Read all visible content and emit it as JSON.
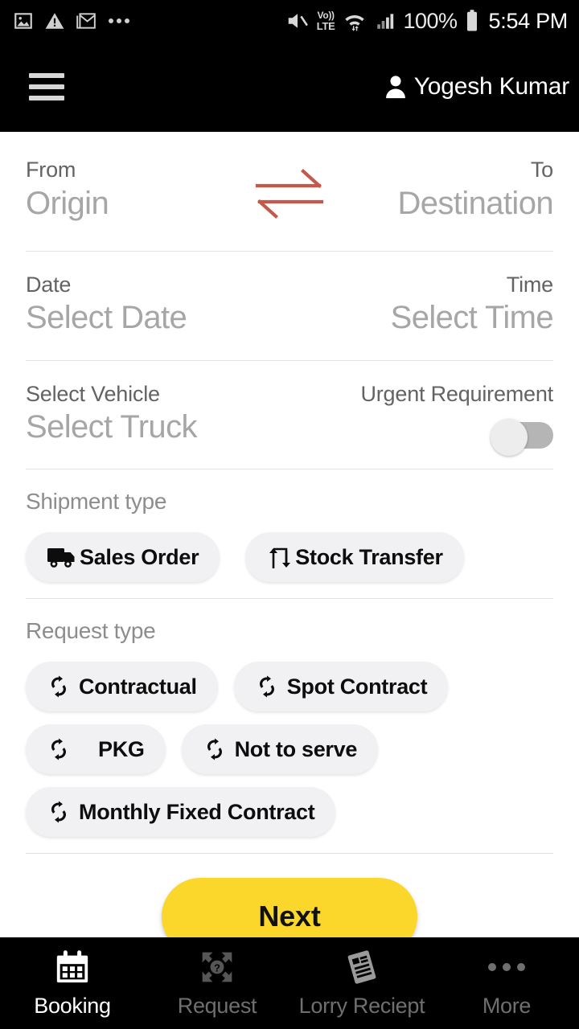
{
  "statusbar": {
    "left_icons": [
      "image-icon",
      "warning-icon",
      "gmail-icon",
      "more-notifications-icon"
    ],
    "mute_icon": "volume-mute-icon",
    "volte_top": "Vo))",
    "volte_bottom": "LTE",
    "wifi_icon": "wifi-transfer-icon",
    "signal_icon": "cellular-signal-icon",
    "battery_percent": "100%",
    "battery_icon": "battery-full-icon",
    "time": "5:54 PM"
  },
  "appbar": {
    "menu_icon": "hamburger-menu-icon",
    "avatar_icon": "person-icon",
    "user_name": "Yogesh Kumar"
  },
  "form": {
    "from": {
      "label": "From",
      "placeholder": "Origin"
    },
    "to": {
      "label": "To",
      "placeholder": "Destination"
    },
    "swap_icon": "swap-arrows-icon",
    "swap_color": "#c4584a",
    "date": {
      "label": "Date",
      "placeholder": "Select Date"
    },
    "time": {
      "label": "Time",
      "placeholder": "Select Time"
    },
    "vehicle": {
      "label": "Select Vehicle",
      "placeholder": "Select Truck"
    },
    "urgent": {
      "label": "Urgent Requirement",
      "state": "off"
    }
  },
  "shipment_type": {
    "title": "Shipment type",
    "options": [
      {
        "label": "Sales Order",
        "icon": "truck-icon"
      },
      {
        "label": "Stock Transfer",
        "icon": "transfer-arrows-icon"
      }
    ]
  },
  "request_type": {
    "title": "Request type",
    "options": [
      {
        "label": "Contractual",
        "icon": "sync-icon"
      },
      {
        "label": "Spot Contract",
        "icon": "sync-icon"
      },
      {
        "label": "PKG",
        "icon": "sync-icon"
      },
      {
        "label": "Not to serve",
        "icon": "sync-icon"
      },
      {
        "label": "Monthly Fixed Contract",
        "icon": "sync-icon"
      }
    ]
  },
  "next_button": {
    "label": "Next",
    "color": "#fbd72b"
  },
  "bottomnav": {
    "items": [
      {
        "label": "Booking",
        "icon": "calendar-icon",
        "active": true
      },
      {
        "label": "Request",
        "icon": "request-help-icon",
        "active": false
      },
      {
        "label": "Lorry Reciept",
        "icon": "receipt-icon",
        "active": false
      },
      {
        "label": "More",
        "icon": "more-dots-icon",
        "active": false
      }
    ]
  }
}
